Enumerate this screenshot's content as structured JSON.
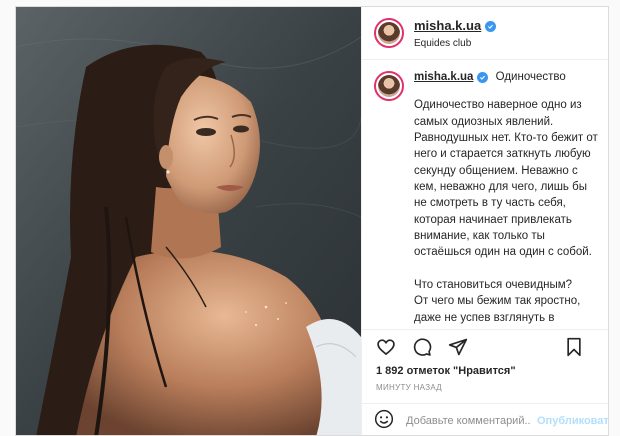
{
  "post": {
    "username": "misha.k.ua",
    "location": "Equides club",
    "caption_title": "Одиночество",
    "caption_body": "Одиночество наверное одно из самых одиозных явлений. Равнодушных нет. Кто-то бежит от него и старается заткнуть любую секунду общением. Неважно с кем, неважно для чего, лишь бы не смотреть в ту часть себя, которая начинает привлекать внимание, как только ты остаёшься один на один с собой.\n\nЧто становиться очевидным?\nОт чего мы бежим так яростно, даже не успев взглянуть в собственные глаза.\n\nК",
    "likes": "1 892 отметок \"Нравится\"",
    "time": "МИНУТУ НАЗАД",
    "comment_placeholder": "Добавьте комментарий...",
    "publish_label": "Опубликовать"
  },
  "icons": {
    "like": "heart-icon",
    "comment": "comment-icon",
    "share": "paper-plane-icon",
    "save": "bookmark-icon",
    "emoji": "smiley-icon",
    "verified": "verified-badge-icon"
  },
  "colors": {
    "verified": "#3897f0",
    "publish_disabled": "#b2dffc",
    "avatar_ring": "#e1306c"
  }
}
